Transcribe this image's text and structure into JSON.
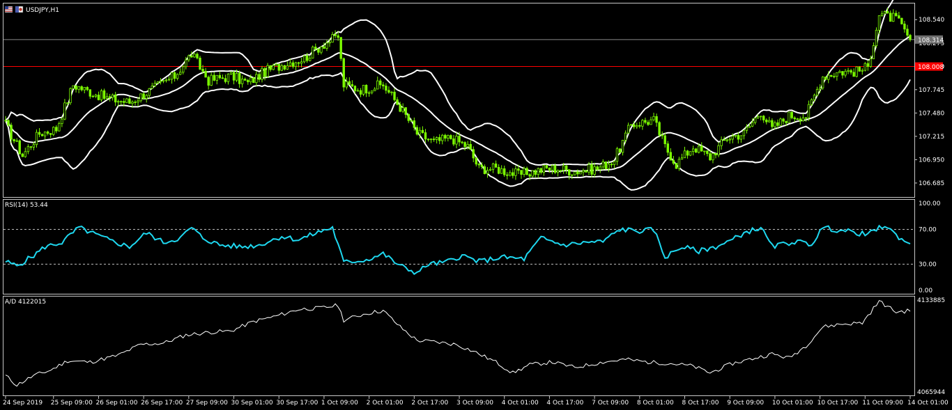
{
  "window": {
    "symbol_title": "USDJPY,H1"
  },
  "colors": {
    "background": "#000000",
    "candle": "#7CFC00",
    "bollinger": "#FFFFFF",
    "rsi": "#1ED8F0",
    "ad": "#FFFFFF",
    "ask_line": "#8a8a8a",
    "level_line": "#FF0000",
    "price_tag_bg": "#6e6e6e",
    "level_tag_bg": "#FF0000"
  },
  "price_axis": {
    "ticks": [
      "108.540",
      "108.275",
      "108.010",
      "107.745",
      "107.480",
      "107.215",
      "106.950",
      "106.685"
    ],
    "current_price": "108.314",
    "level_price": "108.008"
  },
  "rsi_panel": {
    "title": "RSI(14) 53.44",
    "ticks": [
      "100.00",
      "70.00",
      "30.00",
      "0.00"
    ]
  },
  "ad_panel": {
    "title": "A/D 4122015",
    "ticks": [
      "4133885",
      "4065944"
    ]
  },
  "time_axis": {
    "labels": [
      "24 Sep 2019",
      "25 Sep 09:00",
      "26 Sep 01:00",
      "26 Sep 17:00",
      "27 Sep 09:00",
      "30 Sep 01:00",
      "30 Sep 17:00",
      "1 Oct 09:00",
      "2 Oct 01:00",
      "2 Oct 17:00",
      "3 Oct 09:00",
      "4 Oct 01:00",
      "4 Oct 17:00",
      "7 Oct 09:00",
      "8 Oct 01:00",
      "8 Oct 17:00",
      "9 Oct 09:00",
      "10 Oct 01:00",
      "10 Oct 17:00",
      "11 Oct 09:00",
      "14 Oct 01:00"
    ]
  },
  "chart_data": [
    {
      "type": "line",
      "title": "USDJPY,H1",
      "subtype": "candlestick with Bollinger Bands",
      "ylim": [
        106.55,
        108.7
      ],
      "x_label_index": [
        0,
        17,
        33,
        49,
        65,
        81,
        97,
        113,
        129,
        145,
        161,
        177,
        193,
        209,
        225,
        241,
        257,
        273,
        289,
        305,
        321
      ],
      "price_keypoints": [
        [
          0,
          107.35
        ],
        [
          6,
          107.0
        ],
        [
          12,
          107.25
        ],
        [
          18,
          107.3
        ],
        [
          24,
          107.8
        ],
        [
          30,
          107.72
        ],
        [
          36,
          107.65
        ],
        [
          44,
          107.6
        ],
        [
          52,
          107.75
        ],
        [
          60,
          107.9
        ],
        [
          66,
          108.15
        ],
        [
          72,
          107.85
        ],
        [
          80,
          107.9
        ],
        [
          86,
          107.82
        ],
        [
          92,
          107.95
        ],
        [
          100,
          108.05
        ],
        [
          106,
          108.1
        ],
        [
          112,
          108.25
        ],
        [
          118,
          108.35
        ],
        [
          120,
          107.8
        ],
        [
          126,
          107.75
        ],
        [
          134,
          107.8
        ],
        [
          140,
          107.55
        ],
        [
          146,
          107.25
        ],
        [
          152,
          107.15
        ],
        [
          158,
          107.2
        ],
        [
          164,
          107.1
        ],
        [
          168,
          106.85
        ],
        [
          174,
          106.85
        ],
        [
          182,
          106.78
        ],
        [
          188,
          106.82
        ],
        [
          192,
          106.85
        ],
        [
          196,
          106.85
        ],
        [
          202,
          106.82
        ],
        [
          210,
          106.85
        ],
        [
          216,
          106.95
        ],
        [
          222,
          107.35
        ],
        [
          230,
          107.4
        ],
        [
          234,
          107.1
        ],
        [
          238,
          106.9
        ],
        [
          244,
          107.1
        ],
        [
          250,
          106.98
        ],
        [
          256,
          107.2
        ],
        [
          262,
          107.25
        ],
        [
          268,
          107.5
        ],
        [
          272,
          107.3
        ],
        [
          278,
          107.45
        ],
        [
          284,
          107.45
        ],
        [
          290,
          107.9
        ],
        [
          296,
          107.95
        ],
        [
          302,
          107.95
        ],
        [
          306,
          108.0
        ],
        [
          310,
          108.6
        ],
        [
          316,
          108.55
        ],
        [
          321,
          108.314
        ]
      ],
      "series": [
        {
          "name": "",
          "style": "candles"
        },
        {
          "name": "",
          "style": "bollinger-upper"
        },
        {
          "name": "",
          "style": "bollinger-middle"
        },
        {
          "name": "",
          "style": "bollinger-lower"
        }
      ],
      "horizontal_lines": [
        108.314,
        108.008
      ]
    },
    {
      "type": "line",
      "title": "RSI(14) 53.44",
      "ylim": [
        0,
        100
      ],
      "levels": [
        70,
        30
      ],
      "keypoints": [
        [
          0,
          33
        ],
        [
          4,
          28
        ],
        [
          10,
          40
        ],
        [
          14,
          50
        ],
        [
          20,
          55
        ],
        [
          26,
          72
        ],
        [
          32,
          64
        ],
        [
          38,
          56
        ],
        [
          44,
          50
        ],
        [
          50,
          66
        ],
        [
          56,
          55
        ],
        [
          62,
          60
        ],
        [
          66,
          72
        ],
        [
          70,
          60
        ],
        [
          76,
          52
        ],
        [
          84,
          50
        ],
        [
          90,
          52
        ],
        [
          98,
          62
        ],
        [
          104,
          58
        ],
        [
          112,
          68
        ],
        [
          116,
          72
        ],
        [
          120,
          32
        ],
        [
          128,
          35
        ],
        [
          134,
          42
        ],
        [
          140,
          28
        ],
        [
          146,
          20
        ],
        [
          150,
          30
        ],
        [
          156,
          32
        ],
        [
          162,
          40
        ],
        [
          168,
          33
        ],
        [
          176,
          38
        ],
        [
          184,
          36
        ],
        [
          190,
          60
        ],
        [
          198,
          52
        ],
        [
          206,
          55
        ],
        [
          212,
          56
        ],
        [
          218,
          70
        ],
        [
          226,
          68
        ],
        [
          230,
          70
        ],
        [
          234,
          38
        ],
        [
          240,
          50
        ],
        [
          246,
          45
        ],
        [
          252,
          50
        ],
        [
          258,
          58
        ],
        [
          262,
          66
        ],
        [
          268,
          72
        ],
        [
          272,
          50
        ],
        [
          280,
          56
        ],
        [
          286,
          53
        ],
        [
          290,
          72
        ],
        [
          298,
          68
        ],
        [
          306,
          64
        ],
        [
          312,
          75
        ],
        [
          316,
          63
        ],
        [
          321,
          53.44
        ]
      ]
    },
    {
      "type": "line",
      "title": "A/D 4122015",
      "ylim": [
        4065944,
        4133885
      ],
      "keypoints": [
        [
          0,
          4078000
        ],
        [
          4,
          4071000
        ],
        [
          10,
          4078000
        ],
        [
          16,
          4082000
        ],
        [
          22,
          4089000
        ],
        [
          30,
          4088000
        ],
        [
          40,
          4093000
        ],
        [
          48,
          4101000
        ],
        [
          56,
          4102000
        ],
        [
          64,
          4108000
        ],
        [
          72,
          4110000
        ],
        [
          80,
          4111000
        ],
        [
          88,
          4118000
        ],
        [
          96,
          4122000
        ],
        [
          104,
          4127000
        ],
        [
          112,
          4128000
        ],
        [
          118,
          4130000
        ],
        [
          120,
          4119000
        ],
        [
          128,
          4124000
        ],
        [
          134,
          4126000
        ],
        [
          140,
          4114000
        ],
        [
          146,
          4104000
        ],
        [
          152,
          4103000
        ],
        [
          160,
          4101000
        ],
        [
          166,
          4096000
        ],
        [
          174,
          4088000
        ],
        [
          180,
          4080000
        ],
        [
          186,
          4086000
        ],
        [
          194,
          4088000
        ],
        [
          202,
          4084000
        ],
        [
          212,
          4088000
        ],
        [
          220,
          4090000
        ],
        [
          228,
          4088000
        ],
        [
          236,
          4087000
        ],
        [
          244,
          4085000
        ],
        [
          250,
          4080000
        ],
        [
          258,
          4087000
        ],
        [
          266,
          4091000
        ],
        [
          272,
          4094000
        ],
        [
          278,
          4091000
        ],
        [
          284,
          4100000
        ],
        [
          290,
          4114000
        ],
        [
          296,
          4116000
        ],
        [
          304,
          4117000
        ],
        [
          310,
          4133000
        ],
        [
          316,
          4125000
        ],
        [
          321,
          4126000
        ]
      ]
    }
  ]
}
